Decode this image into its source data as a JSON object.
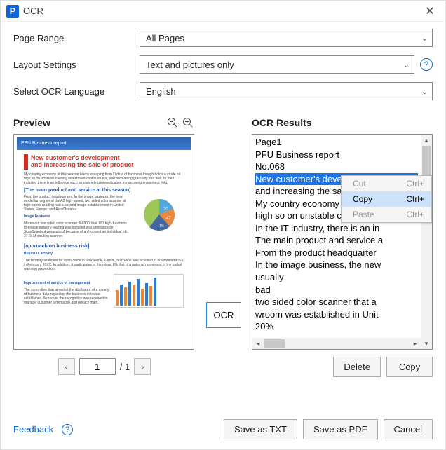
{
  "titlebar": {
    "app_initial": "P",
    "title": "OCR"
  },
  "form": {
    "page_range": {
      "label": "Page Range",
      "value": "All Pages"
    },
    "layout": {
      "label": "Layout Settings",
      "value": "Text and pictures only"
    },
    "language": {
      "label": "Select OCR Language",
      "value": "English"
    }
  },
  "preview": {
    "heading": "Preview",
    "page_input": "1",
    "page_total": "/ 1",
    "doc": {
      "banner": "PFU Business report",
      "headline1": "New customer's development",
      "headline2": "and increasing the sale of product",
      "intro": "My country economy at this season keeps escaping from Dideta of business though holds a crude oil high so on unstable causing investment continues still, and recovering gradually and well. In the IT industry, there is an influence such as competing intensification in narrowing investment field.",
      "sec1": "[The main product and service at this season]",
      "para1": "From the product headquarters. In the image business, the new model turning on of the A3 high-speed, two sided color scanner at high-speed reading had a second image establishment in United States, Europe, and Asia/Oceania.",
      "sec1b": "Image business",
      "para1b": "Moreover, two sided color scanner 'fi-6800' that 100 high-functions to enable industry-leading was installed was announced in ScanSnap[sukyanasutoru] because of a shop and an individual etc. 27 DLM solution scanner.",
      "sec2": "[approach on business risk]",
      "sec2b": "Business activity",
      "sec3": "Improvement of service of management"
    }
  },
  "ocr_button": "OCR",
  "results": {
    "heading": "OCR Results",
    "lines": [
      "Page1",
      "PFU Business report",
      "No.068",
      "New customer's development",
      "and increasing the sale of product",
      "My country economy at th",
      "high so on unstable causing ",
      "In the IT industry, there is an in",
      "The main product and service a",
      "From the product headquarter",
      "In the image business, the new",
      "usually",
      "bad",
      "two sided color scanner that a",
      "wroom was established in Unit",
      "20%"
    ],
    "selected_index": 3,
    "context_menu": [
      {
        "label": "Cut",
        "hint": "Ctrl+",
        "enabled": false
      },
      {
        "label": "Copy",
        "hint": "Ctrl+",
        "enabled": true
      },
      {
        "label": "Paste",
        "hint": "Ctrl+",
        "enabled": false
      }
    ],
    "delete_btn": "Delete",
    "copy_btn": "Copy"
  },
  "footer": {
    "feedback": "Feedback",
    "save_txt": "Save as TXT",
    "save_pdf": "Save as PDF",
    "cancel": "Cancel"
  }
}
